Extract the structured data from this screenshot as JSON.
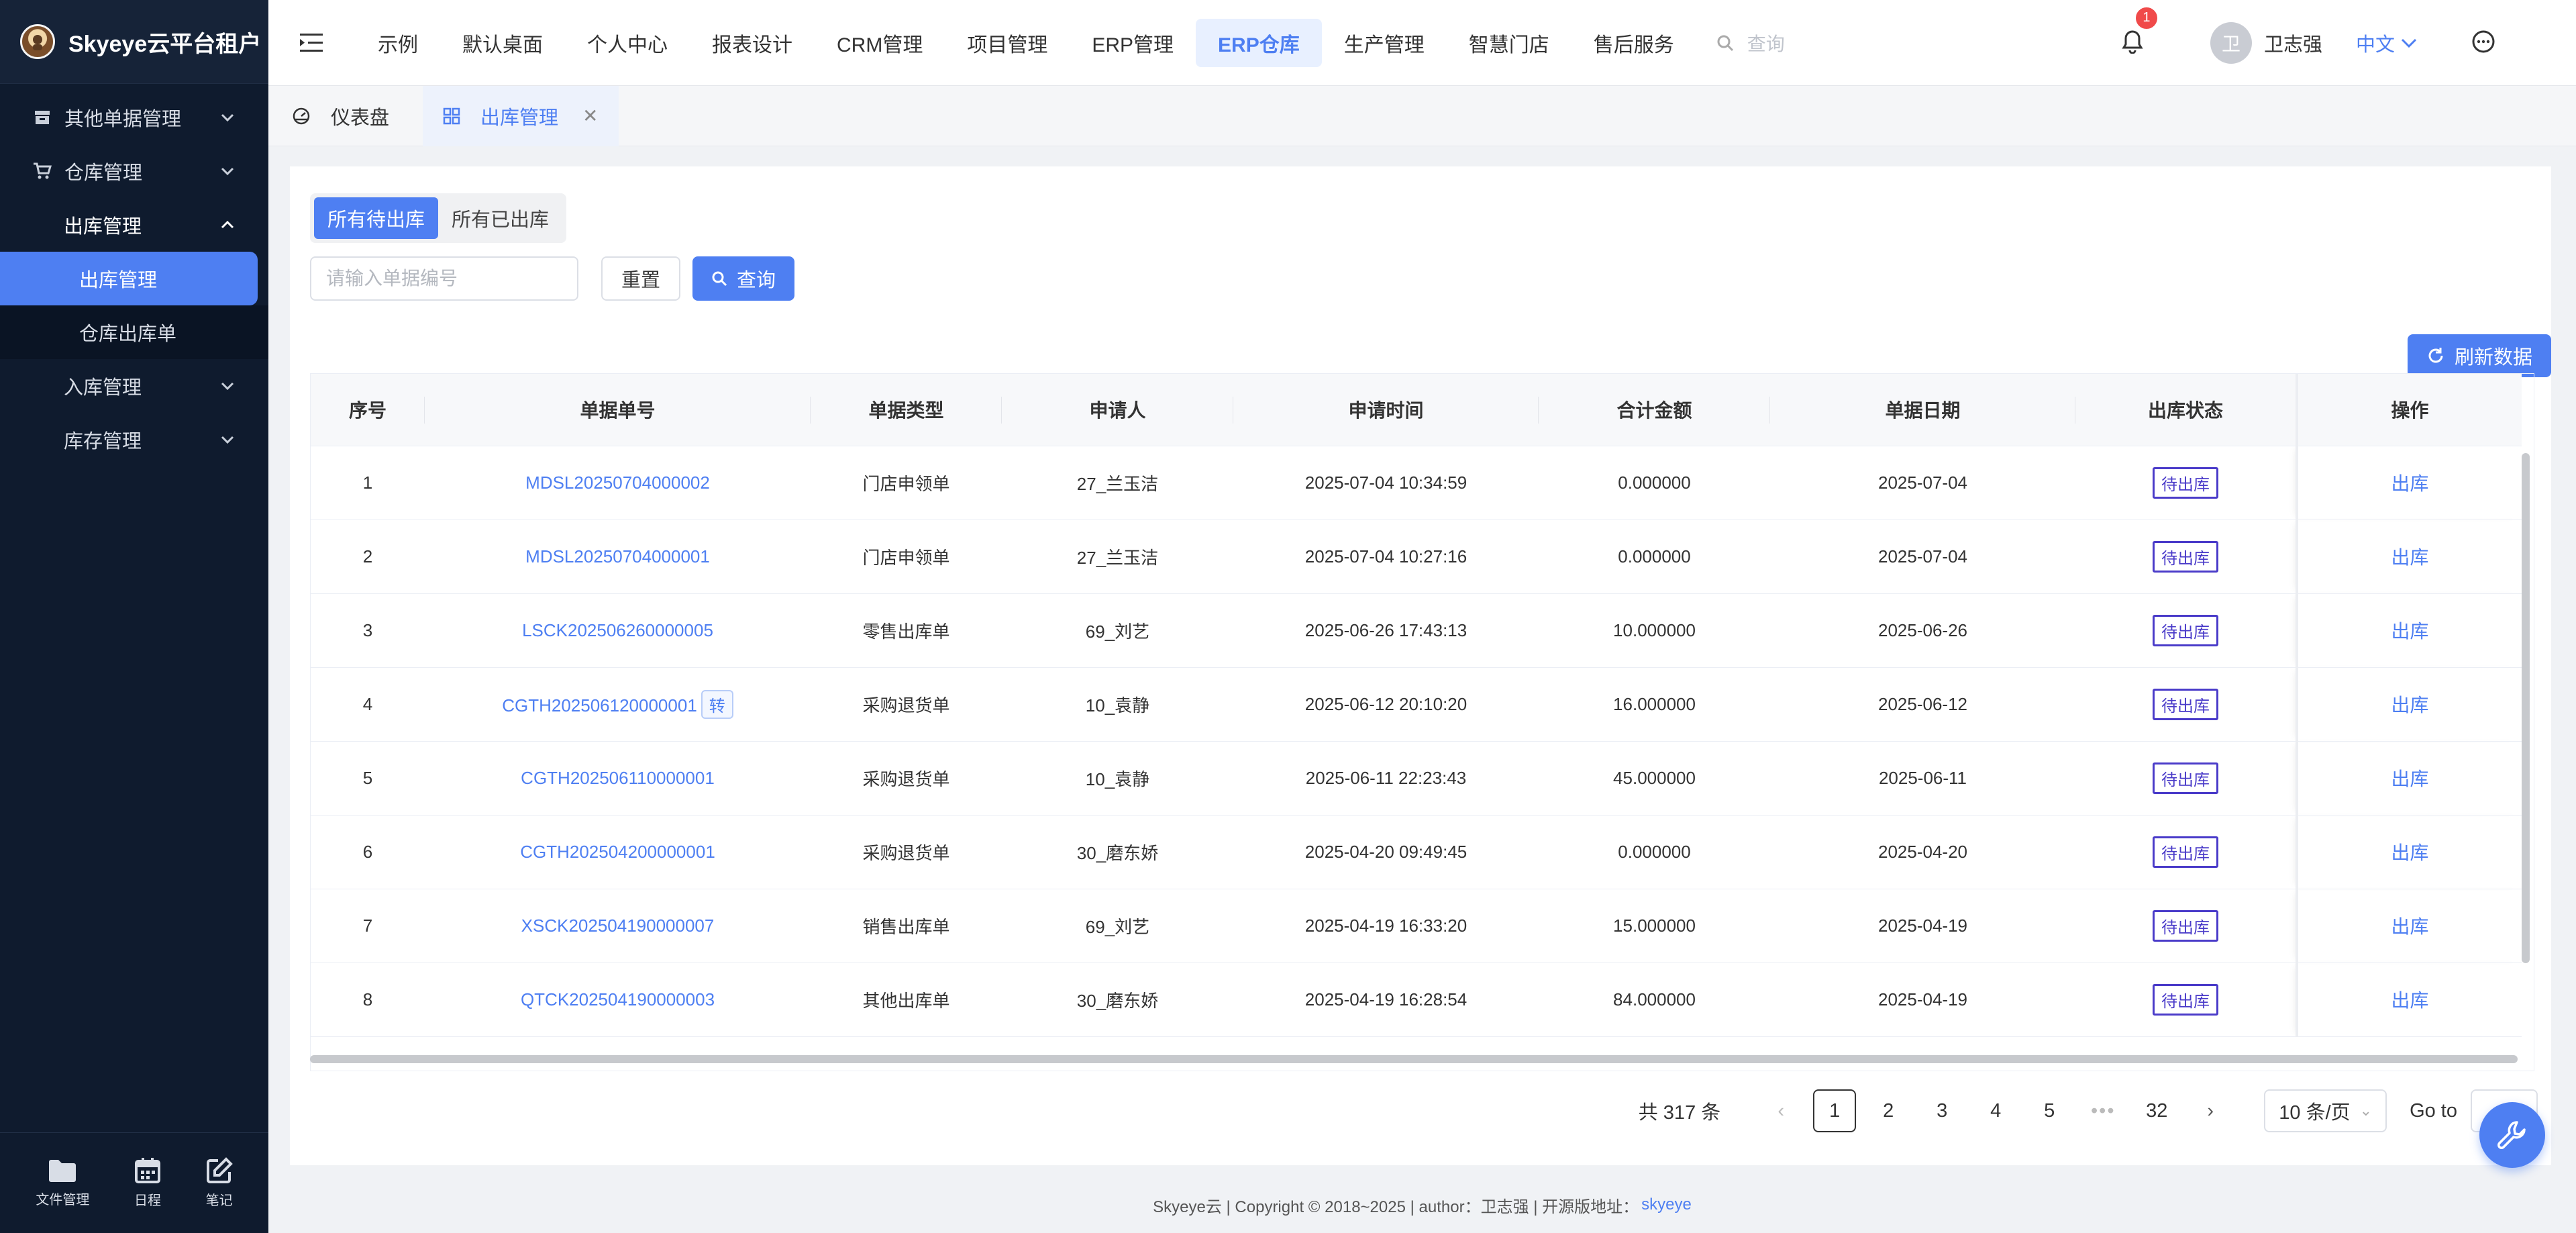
{
  "brand": {
    "title": "Skyeye云平台租户"
  },
  "sidebar": {
    "items": [
      {
        "label": "其他单据管理",
        "icon": "inbox-icon",
        "level": 1,
        "expanded": false
      },
      {
        "label": "仓库管理",
        "icon": "cart-icon",
        "level": 1,
        "expanded": false
      },
      {
        "label": "出库管理",
        "level": 2,
        "expanded": true
      },
      {
        "label": "出库管理",
        "level": 3,
        "active": true
      },
      {
        "label": "仓库出库单",
        "level": 3
      },
      {
        "label": "入库管理",
        "level": 2,
        "expanded": false
      },
      {
        "label": "库存管理",
        "level": 2,
        "expanded": false
      }
    ],
    "bottom": [
      {
        "label": "文件管理",
        "icon": "folder-icon"
      },
      {
        "label": "日程",
        "icon": "calendar-icon"
      },
      {
        "label": "笔记",
        "icon": "edit-icon"
      }
    ]
  },
  "topnav": {
    "items": [
      "示例",
      "默认桌面",
      "个人中心",
      "报表设计",
      "CRM管理",
      "项目管理",
      "ERP管理",
      "ERP仓库",
      "生产管理",
      "智慧门店",
      "售后服务"
    ],
    "active_index": 7,
    "search_placeholder": "查询"
  },
  "header": {
    "notification_count": "1",
    "user_initial": "卫",
    "user_name": "卫志强",
    "language": "中文"
  },
  "tabs": [
    {
      "label": "仪表盘",
      "icon": "dashboard-icon"
    },
    {
      "label": "出库管理",
      "icon": "grid-icon",
      "active": true
    }
  ],
  "filters": {
    "seg_options": [
      "所有待出库",
      "所有已出库"
    ],
    "seg_active": 0,
    "input_placeholder": "请输入单据编号",
    "input_value": "",
    "reset_label": "重置",
    "search_label": "查询",
    "refresh_label": "刷新数据"
  },
  "table": {
    "columns": [
      "序号",
      "单据单号",
      "单据类型",
      "申请人",
      "申请时间",
      "合计金额",
      "单据日期",
      "出库状态",
      "操作"
    ],
    "rows": [
      {
        "idx": "1",
        "no": "MDSL20250704000002",
        "tag": "",
        "type": "门店申领单",
        "applicant": "27_兰玉洁",
        "time": "2025-07-04 10:34:59",
        "amount": "0.000000",
        "date": "2025-07-04",
        "status": "待出库",
        "op": "出库"
      },
      {
        "idx": "2",
        "no": "MDSL20250704000001",
        "tag": "",
        "type": "门店申领单",
        "applicant": "27_兰玉洁",
        "time": "2025-07-04 10:27:16",
        "amount": "0.000000",
        "date": "2025-07-04",
        "status": "待出库",
        "op": "出库"
      },
      {
        "idx": "3",
        "no": "LSCK202506260000005",
        "tag": "",
        "type": "零售出库单",
        "applicant": "69_刘艺",
        "time": "2025-06-26 17:43:13",
        "amount": "10.000000",
        "date": "2025-06-26",
        "status": "待出库",
        "op": "出库"
      },
      {
        "idx": "4",
        "no": "CGTH202506120000001",
        "tag": "转",
        "type": "采购退货单",
        "applicant": "10_袁静",
        "time": "2025-06-12 20:10:20",
        "amount": "16.000000",
        "date": "2025-06-12",
        "status": "待出库",
        "op": "出库"
      },
      {
        "idx": "5",
        "no": "CGTH202506110000001",
        "tag": "",
        "type": "采购退货单",
        "applicant": "10_袁静",
        "time": "2025-06-11 22:23:43",
        "amount": "45.000000",
        "date": "2025-06-11",
        "status": "待出库",
        "op": "出库"
      },
      {
        "idx": "6",
        "no": "CGTH202504200000001",
        "tag": "",
        "type": "采购退货单",
        "applicant": "30_磨东娇",
        "time": "2025-04-20 09:49:45",
        "amount": "0.000000",
        "date": "2025-04-20",
        "status": "待出库",
        "op": "出库"
      },
      {
        "idx": "7",
        "no": "XSCK202504190000007",
        "tag": "",
        "type": "销售出库单",
        "applicant": "69_刘艺",
        "time": "2025-04-19 16:33:20",
        "amount": "15.000000",
        "date": "2025-04-19",
        "status": "待出库",
        "op": "出库"
      },
      {
        "idx": "8",
        "no": "QTCK202504190000003",
        "tag": "",
        "type": "其他出库单",
        "applicant": "30_磨东娇",
        "time": "2025-04-19 16:28:54",
        "amount": "84.000000",
        "date": "2025-04-19",
        "status": "待出库",
        "op": "出库"
      }
    ]
  },
  "pagination": {
    "total_text": "共 317 条",
    "pages": [
      "1",
      "2",
      "3",
      "4",
      "5"
    ],
    "ellipsis": "•••",
    "last_page": "32",
    "current": "1",
    "page_size": "10 条/页",
    "goto_label": "Go to"
  },
  "footer": {
    "text": "Skyeye云 | Copyright © 2018~2025 | author：卫志强 | 开源版地址：",
    "link": "skyeye"
  }
}
